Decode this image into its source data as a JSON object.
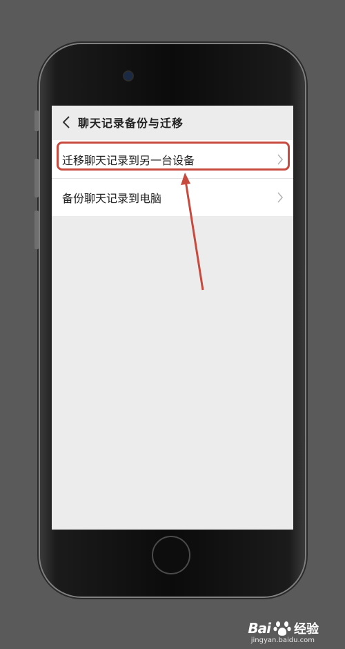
{
  "header": {
    "title": "聊天记录备份与迁移",
    "back_icon": "chevron-left-icon"
  },
  "menu": {
    "items": [
      {
        "label": "迁移聊天记录到另一台设备",
        "icon": "chevron-right-icon",
        "highlighted": true
      },
      {
        "label": "备份聊天记录到电脑",
        "icon": "chevron-right-icon",
        "highlighted": false
      }
    ]
  },
  "annotation": {
    "color": "#c84a3e"
  },
  "watermark": {
    "brand_left": "Bai",
    "brand_right": "经验",
    "url": "jingyan.baidu.com"
  }
}
